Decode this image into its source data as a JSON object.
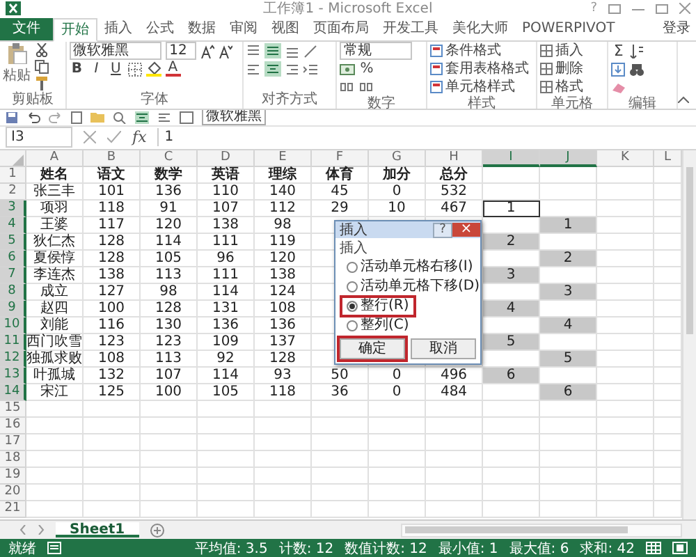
{
  "window": {
    "title": "工作簿1 - Microsoft Excel",
    "help": "?"
  },
  "tabs": [
    {
      "label": "文件",
      "kind": "file",
      "selected": false
    },
    {
      "label": "开始",
      "kind": "tab",
      "selected": true
    },
    {
      "label": "插入",
      "kind": "tab",
      "selected": false
    },
    {
      "label": "公式",
      "kind": "tab",
      "selected": false
    },
    {
      "label": "数据",
      "kind": "tab",
      "selected": false
    },
    {
      "label": "审阅",
      "kind": "tab",
      "selected": false
    },
    {
      "label": "视图",
      "kind": "tab",
      "selected": false
    },
    {
      "label": "页面布局",
      "kind": "tab",
      "selected": false
    },
    {
      "label": "开发工具",
      "kind": "tab",
      "selected": false
    },
    {
      "label": "美化大师",
      "kind": "tab",
      "selected": false
    },
    {
      "label": "POWERPIVOT",
      "kind": "tab",
      "selected": false
    }
  ],
  "account": "登录",
  "ribbon": {
    "clipboard": {
      "label": "剪贴板",
      "paste": "粘贴"
    },
    "font": {
      "label": "字体",
      "name": "微软雅黑",
      "size": "12",
      "bold": "B",
      "italic": "I",
      "underline": "U",
      "color_letter": "A"
    },
    "alignment": {
      "label": "对齐方式"
    },
    "number": {
      "label": "数字",
      "format": "常规",
      "percent": "%"
    },
    "styles": {
      "label": "样式",
      "items": [
        "条件格式",
        "套用表格格式",
        "单元格样式"
      ]
    },
    "cells": {
      "label": "单元格",
      "items": [
        "插入",
        "删除",
        "格式"
      ]
    },
    "editing": {
      "label": "编辑",
      "sum": "Σ"
    }
  },
  "quick_access": {
    "font_box": "微软雅黑"
  },
  "formula_bar": {
    "name_box": "I3",
    "fx": "fx",
    "value": "1"
  },
  "sheet": {
    "columns": [
      {
        "label": "A",
        "selected": false
      },
      {
        "label": "B",
        "selected": false
      },
      {
        "label": "C",
        "selected": false
      },
      {
        "label": "D",
        "selected": false
      },
      {
        "label": "E",
        "selected": false
      },
      {
        "label": "F",
        "selected": false
      },
      {
        "label": "G",
        "selected": false
      },
      {
        "label": "H",
        "selected": false
      },
      {
        "label": "I",
        "selected": true
      },
      {
        "label": "J",
        "selected": true
      },
      {
        "label": "K",
        "selected": false
      },
      {
        "label": "L",
        "selected": false
      }
    ],
    "rows": [
      {
        "num": "1",
        "selected": false,
        "header": true,
        "cells": [
          "姓名",
          "语文",
          "数学",
          "英语",
          "理综",
          "体育",
          "加分",
          "总分"
        ]
      },
      {
        "num": "2",
        "selected": false,
        "header": false,
        "cells": [
          "张三丰",
          "101",
          "136",
          "110",
          "140",
          "45",
          "0",
          "532"
        ]
      },
      {
        "num": "3",
        "selected": true,
        "header": false,
        "cells": [
          "项羽",
          "118",
          "91",
          "107",
          "112",
          "29",
          "10",
          "467"
        ],
        "col_i": {
          "text": "1",
          "selected": false,
          "active": true
        }
      },
      {
        "num": "4",
        "selected": true,
        "header": false,
        "cells": [
          "王婆",
          "117",
          "120",
          "138",
          "98"
        ],
        "col_j": {
          "text": "1",
          "selected": true,
          "active": false
        }
      },
      {
        "num": "5",
        "selected": true,
        "header": false,
        "cells": [
          "狄仁杰",
          "128",
          "114",
          "111",
          "119"
        ],
        "col_i": {
          "text": "2",
          "selected": true,
          "active": false
        }
      },
      {
        "num": "6",
        "selected": true,
        "header": false,
        "cells": [
          "夏侯惇",
          "128",
          "105",
          "96",
          "120"
        ],
        "col_j": {
          "text": "2",
          "selected": true,
          "active": false
        }
      },
      {
        "num": "7",
        "selected": true,
        "header": false,
        "cells": [
          "李连杰",
          "138",
          "113",
          "111",
          "138"
        ],
        "col_i": {
          "text": "3",
          "selected": true,
          "active": false
        }
      },
      {
        "num": "8",
        "selected": true,
        "header": false,
        "cells": [
          "成立",
          "127",
          "98",
          "114",
          "124"
        ],
        "col_j": {
          "text": "3",
          "selected": true,
          "active": false
        }
      },
      {
        "num": "9",
        "selected": true,
        "header": false,
        "cells": [
          "赵四",
          "100",
          "128",
          "131",
          "108"
        ],
        "col_i": {
          "text": "4",
          "selected": true,
          "active": false
        }
      },
      {
        "num": "10",
        "selected": true,
        "header": false,
        "cells": [
          "刘能",
          "116",
          "130",
          "136",
          "136"
        ],
        "col_j": {
          "text": "4",
          "selected": true,
          "active": false
        }
      },
      {
        "num": "11",
        "selected": true,
        "header": false,
        "cells": [
          "西门吹雪",
          "123",
          "123",
          "109",
          "137"
        ],
        "col_i": {
          "text": "5",
          "selected": true,
          "active": false
        }
      },
      {
        "num": "12",
        "selected": true,
        "header": false,
        "cells": [
          "独孤求败",
          "108",
          "113",
          "92",
          "128"
        ],
        "col_j": {
          "text": "5",
          "selected": true,
          "active": false
        }
      },
      {
        "num": "13",
        "selected": true,
        "header": false,
        "cells": [
          "叶孤城",
          "132",
          "107",
          "114",
          "93",
          "50",
          "0",
          "496"
        ],
        "col_i": {
          "text": "6",
          "selected": true,
          "active": false
        }
      },
      {
        "num": "14",
        "selected": true,
        "header": false,
        "cells": [
          "宋江",
          "125",
          "100",
          "105",
          "118",
          "36",
          "0",
          "484"
        ],
        "col_j": {
          "text": "6",
          "selected": true,
          "active": false
        }
      },
      {
        "num": "15",
        "selected": false,
        "cells": []
      },
      {
        "num": "16",
        "selected": false,
        "cells": []
      },
      {
        "num": "17",
        "selected": false,
        "cells": []
      },
      {
        "num": "18",
        "selected": false,
        "cells": []
      },
      {
        "num": "19",
        "selected": false,
        "cells": []
      },
      {
        "num": "20",
        "selected": false,
        "cells": []
      },
      {
        "num": "21",
        "selected": false,
        "cells": []
      }
    ]
  },
  "dialog": {
    "title": "插入",
    "help": "?",
    "close": "×",
    "group": "插入",
    "options": [
      {
        "label": "活动单元格右移(I)",
        "selected": false,
        "highlighted": false
      },
      {
        "label": "活动单元格下移(D)",
        "selected": false,
        "highlighted": false
      },
      {
        "label": "整行(R)",
        "selected": true,
        "highlighted": true
      },
      {
        "label": "整列(C)",
        "selected": false,
        "highlighted": false
      }
    ],
    "buttons": [
      {
        "label": "确定",
        "highlighted": true
      },
      {
        "label": "取消",
        "highlighted": false
      }
    ]
  },
  "sheet_tabs": [
    {
      "label": "Sheet1",
      "selected": true
    }
  ],
  "status_bar": {
    "ready": "就绪",
    "stats": [
      "平均值: 3.5",
      "计数: 12",
      "数值计数: 12",
      "最小值: 1",
      "最大值: 6",
      "求和: 42"
    ]
  }
}
